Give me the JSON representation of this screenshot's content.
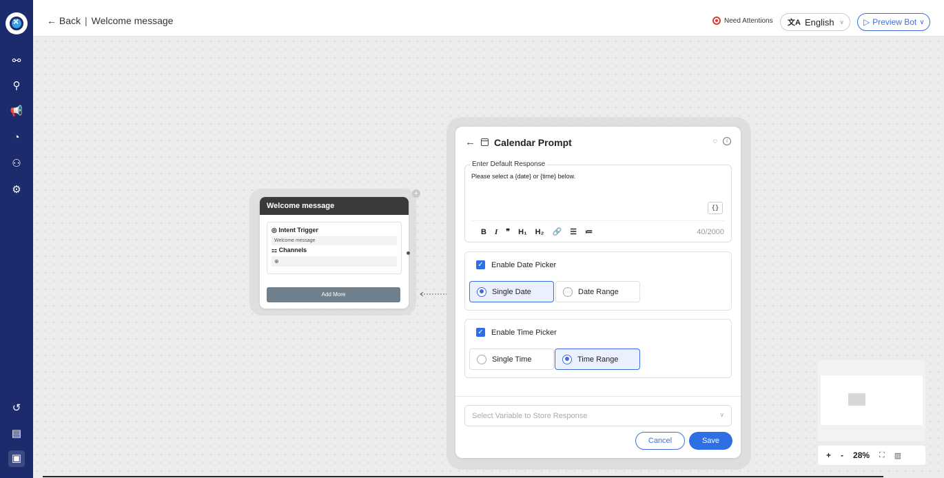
{
  "topbar": {
    "back_label": "← Back",
    "separator": "|",
    "page_title": "Welcome message",
    "attention_label": "Need Attentions",
    "language": "English",
    "preview_label": "Preview Bot"
  },
  "sidebar": {
    "items": [
      {
        "icon": "flow-icon",
        "glyph": "⚯"
      },
      {
        "icon": "integrations-icon",
        "glyph": "⚲"
      },
      {
        "icon": "broadcast-icon",
        "glyph": "📢"
      },
      {
        "icon": "analytics-icon",
        "glyph": "◔"
      },
      {
        "icon": "users-icon",
        "glyph": "⚇"
      },
      {
        "icon": "settings-icon",
        "glyph": "⚙"
      }
    ],
    "bottom_items": [
      {
        "icon": "history-icon",
        "glyph": "↺"
      },
      {
        "icon": "docs-icon",
        "glyph": "▤"
      },
      {
        "icon": "collapse-icon",
        "glyph": "▣"
      }
    ]
  },
  "node": {
    "title": "Welcome message",
    "intent_label": "Intent Trigger",
    "intent_value": "Welcome message",
    "channels_label": "Channels",
    "add_more_label": "Add More"
  },
  "panel": {
    "title": "Calendar Prompt",
    "response_legend": "Enter Default Response",
    "response_text": "Please select a {date} or {time} below.",
    "variable_button": "{}",
    "char_count": "40/2000",
    "toolbar": [
      "B",
      "I",
      "❞",
      "H₁",
      "H₂",
      "🔗",
      "☰",
      "≔"
    ],
    "date_picker": {
      "label": "Enable Date Picker",
      "checked": true,
      "options": [
        {
          "label": "Single Date",
          "selected": true
        },
        {
          "label": "Date Range",
          "selected": false
        }
      ]
    },
    "time_picker": {
      "label": "Enable Time Picker",
      "checked": true,
      "options": [
        {
          "label": "Single Time",
          "selected": false
        },
        {
          "label": "Time Range",
          "selected": true
        }
      ]
    },
    "variable_placeholder": "Select Variable to Store Response",
    "cancel_label": "Cancel",
    "save_label": "Save"
  },
  "zoom": {
    "plus": "+",
    "minus": "-",
    "level": "28%"
  },
  "colors": {
    "sidebar": "#1b2b6b",
    "accent": "#2f6fe4",
    "attention": "#e03a2f"
  }
}
